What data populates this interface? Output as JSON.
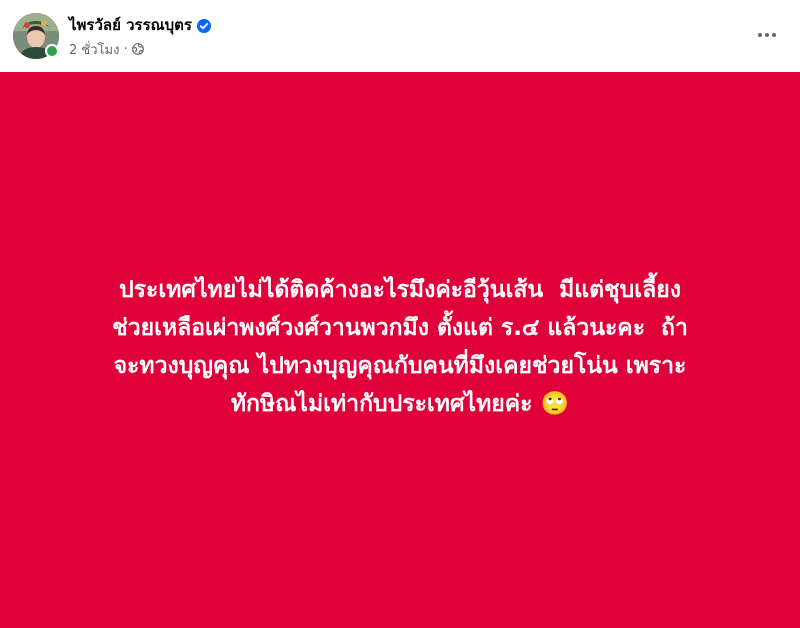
{
  "author": {
    "name": "ไพรวัลย์ วรรณบุตร",
    "verified": true,
    "avatar_icon": "profile-photo",
    "online": true
  },
  "meta": {
    "time": "2 ชั่วโมง",
    "separator": "·",
    "audience_icon": "globe-icon"
  },
  "post": {
    "background_color": "#e0003a",
    "text": "ประเทศไทยไม่ได้ติดค้างอะไรมึงค่ะอีวุ้นเส้น ￼ มีแต่ชุบเลี้ยง\nช่วยเหลือเผ่าพงศ์วงศ์วานพวกมึง ตั้งแต่ ร.๔ แล้วนะคะ ￼ ถ้า\nจะทวงบุญคุณ ไปทวงบุญคุณกับคนที่มึงเคยช่วยโน่น เพราะ\nทักษิณไม่เท่ากับประเทศไทยค่ะ 🙄"
  },
  "colors": {
    "verified_badge": "#0866ff",
    "online_dot": "#31a24c",
    "secondary_text": "#65676b"
  }
}
